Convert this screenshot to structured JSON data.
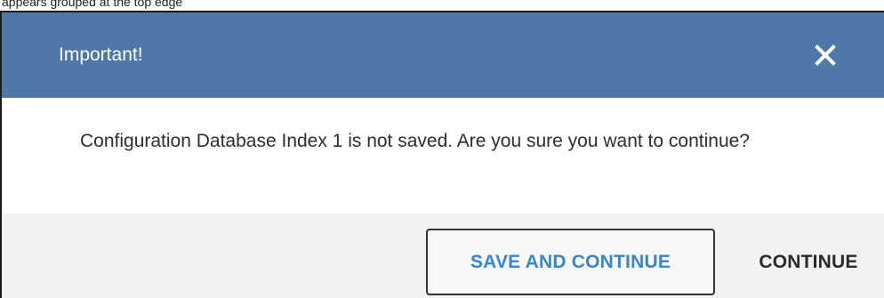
{
  "top_strip": {
    "text": "appears grouped at the top edge"
  },
  "dialog": {
    "title": "Important!",
    "close_icon": "close-icon",
    "message": "Configuration Database Index 1 is not saved. Are you sure you want to continue?",
    "buttons": {
      "save_and_continue": "SAVE AND CONTINUE",
      "continue": "CONTINUE"
    }
  },
  "colors": {
    "header_background": "#4f78a8",
    "header_text": "#ffffff",
    "footer_background": "#f2f2f2",
    "primary_button_text": "#3a87c8",
    "secondary_button_text": "#2a2a2a"
  }
}
